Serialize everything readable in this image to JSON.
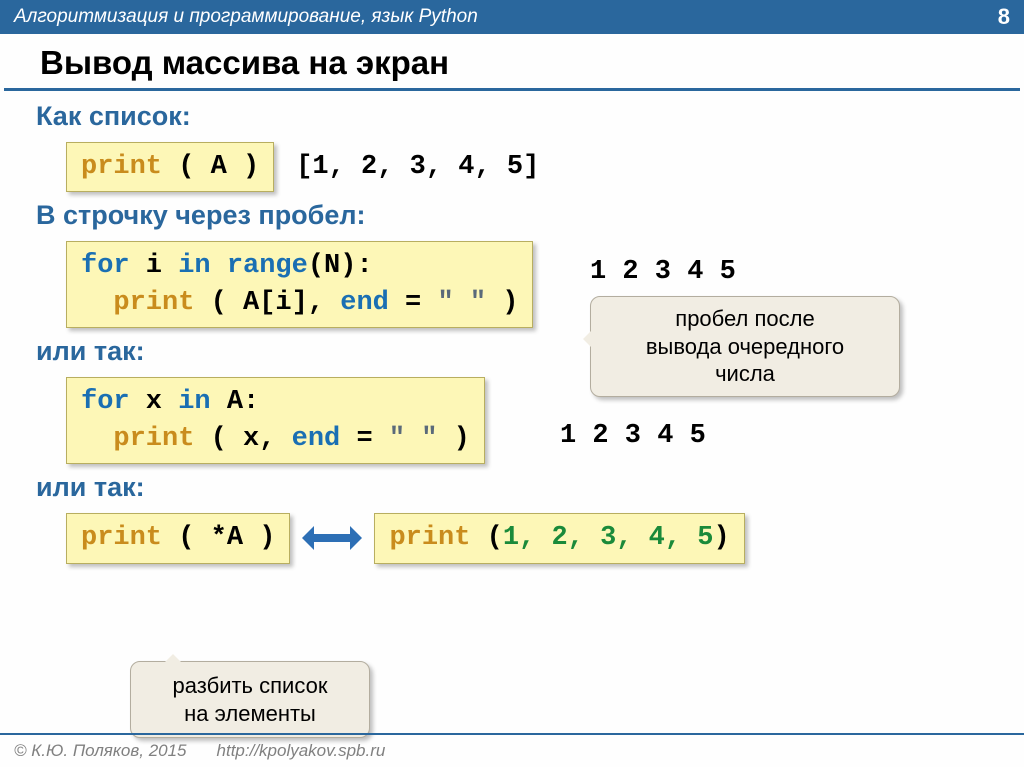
{
  "header": {
    "course": "Алгоритмизация и программирование, язык Python",
    "page": "8"
  },
  "title": "Вывод массива на экран",
  "sections": {
    "as_list": "Как список:",
    "as_line": "В строчку через пробел:",
    "or_so_1": "или так:",
    "or_so_2": "или так:"
  },
  "code": {
    "print": "print",
    "for": "for",
    "in": "in",
    "range": "range",
    "A_arg": " ( A )",
    "list_output": "[1, 2, 3, 4, 5]",
    "c2_line1_a": " i ",
    "c2_line1_b": "(N):",
    "c2_line2_a": " ( A[i], ",
    "c2_kw_end": "end",
    "c2_line2_b": " = ",
    "c2_str": "\" \"",
    "c2_line2_c": " )",
    "out_spaced": "1 2 3 4 5",
    "c3_line1_a": " x ",
    "c3_line1_b": " A:",
    "c3_line2_a": " ( x, ",
    "c4_a": " ( *A )",
    "c5_a": " (",
    "c5_nums": "1, 2, 3, 4, 5",
    "c5_b": ")"
  },
  "bubbles": {
    "b1": "пробел после\nвывода очередного\nчисла",
    "b2": "разбить список\nна элементы"
  },
  "footer": {
    "author": "© К.Ю. Поляков, 2015",
    "url": "http://kpolyakov.spb.ru"
  }
}
